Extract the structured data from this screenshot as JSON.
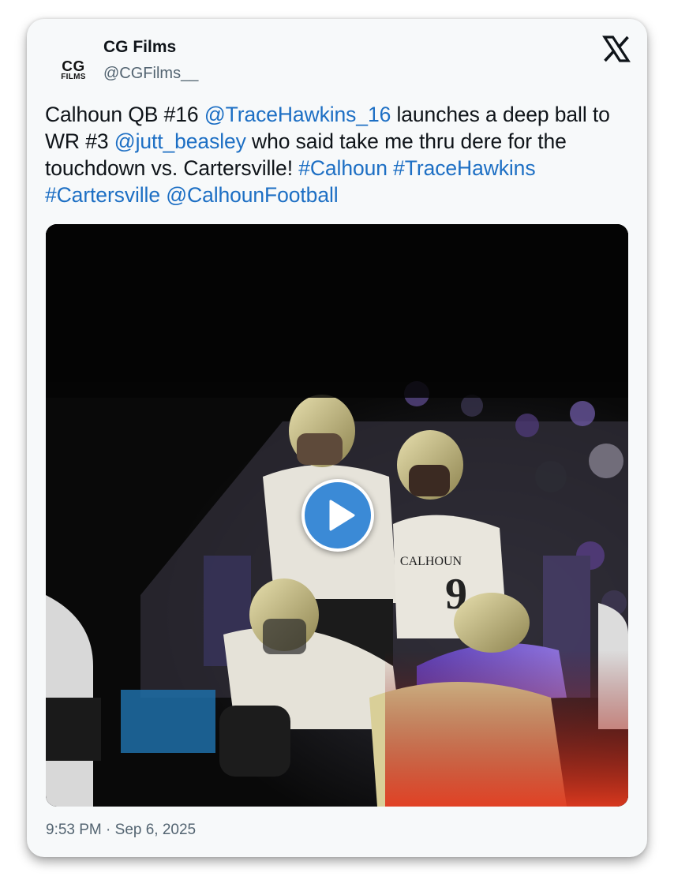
{
  "tweet": {
    "author": {
      "display_name": "CG Films",
      "handle": "@CGFilms__",
      "avatar_text_top": "CG",
      "avatar_text_bottom": "FILMS"
    },
    "text_segments": [
      {
        "text": "Calhoun QB #16 ",
        "type": "text"
      },
      {
        "text": "@TraceHawkins_16",
        "type": "mention"
      },
      {
        "text": " launches a deep ball to WR #3 ",
        "type": "text"
      },
      {
        "text": "@jutt_beasley",
        "type": "mention"
      },
      {
        "text": " who said take me thru dere for the touchdown vs. Cartersville! ",
        "type": "text"
      },
      {
        "text": "#Calhoun",
        "type": "hashtag"
      },
      {
        "text": " ",
        "type": "text"
      },
      {
        "text": "#TraceHawkins",
        "type": "hashtag"
      },
      {
        "text": " ",
        "type": "text"
      },
      {
        "text": "#Cartersville",
        "type": "hashtag"
      },
      {
        "text": " ",
        "type": "text"
      },
      {
        "text": "@CalhounFootball",
        "type": "mention"
      }
    ],
    "media": {
      "type": "video",
      "jersey_text": "CALHOUN",
      "jersey_number": "9"
    },
    "timestamp": "9:53 PM · Sep 6, 2025"
  },
  "icons": {
    "x_logo": "x-logo-icon",
    "play": "play-icon"
  },
  "colors": {
    "link": "#1d6fc4",
    "text": "#0f1419",
    "muted": "#536471",
    "card_bg": "#f7f9fa",
    "play_button": "#3b8ad6"
  }
}
